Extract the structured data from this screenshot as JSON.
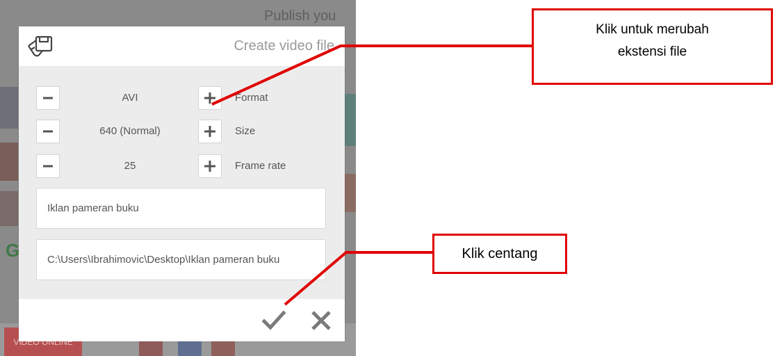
{
  "background": {
    "header_text": "Publish you",
    "bottom_button_label": "VIDEO ONLINE"
  },
  "dialog": {
    "title": "Create video file",
    "options": [
      {
        "value": "AVI",
        "label": "Format"
      },
      {
        "value": "640 (Normal)",
        "label": "Size"
      },
      {
        "value": "25",
        "label": "Frame rate"
      }
    ],
    "name_field": "Iklan pameran buku",
    "path_field": "C:\\Users\\Ibrahimovic\\Desktop\\Iklan pameran buku"
  },
  "callouts": {
    "format_hint": [
      "Klik untuk merubah",
      "ekstensi file"
    ],
    "confirm_hint": "Klik centang"
  },
  "colors": {
    "accent_red": "#e00000",
    "dialog_bg": "#ececec",
    "icon_gray": "#555555"
  },
  "icons": {
    "logo": "film-clapper-icon",
    "minus": "minus-icon",
    "plus": "plus-icon",
    "confirm": "checkmark-icon",
    "cancel": "close-icon"
  }
}
